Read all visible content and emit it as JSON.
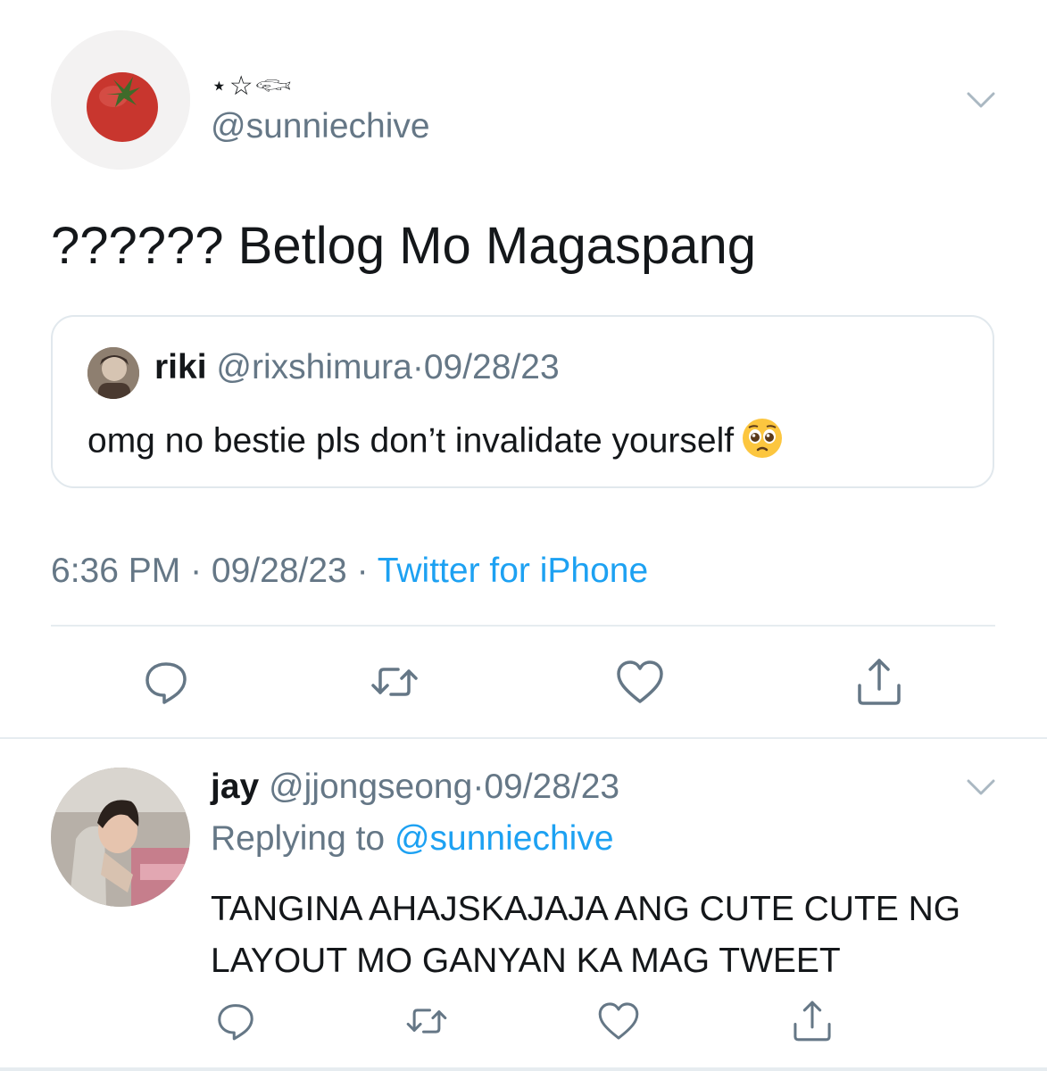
{
  "main_tweet": {
    "display_name": "⋆☆𓆟",
    "handle": "@sunniechive",
    "text": "?????? Betlog Mo Magaspang",
    "quote": {
      "name": "riki",
      "handle": "@rixshimura",
      "separator": "·",
      "date": "09/28/23",
      "text": "omg no bestie pls don’t invalidate yourself"
    },
    "meta": {
      "time": "6:36 PM",
      "sep": " · ",
      "date": "09/28/23",
      "source": "Twitter for iPhone"
    }
  },
  "reply": {
    "name": "jay",
    "handle": "@jjongseong",
    "separator": "·",
    "date": "09/28/23",
    "replying_prefix": "Replying to ",
    "replying_handle": "@sunniechive",
    "text": "TANGINA AHAJSKAJAJA ANG CUTE CUTE NG LAYOUT MO GANYAN KA MAG TWEET"
  },
  "icons": {
    "reply": "reply-icon",
    "retweet": "retweet-icon",
    "like": "heart-icon",
    "share": "share-icon",
    "more": "chevron-down-icon",
    "emoji": "pleading-face-emoji"
  },
  "colors": {
    "text": "#14171a",
    "secondary": "#657786",
    "link": "#1da1f2",
    "border": "#e1e8ed",
    "icon": "#657786"
  }
}
